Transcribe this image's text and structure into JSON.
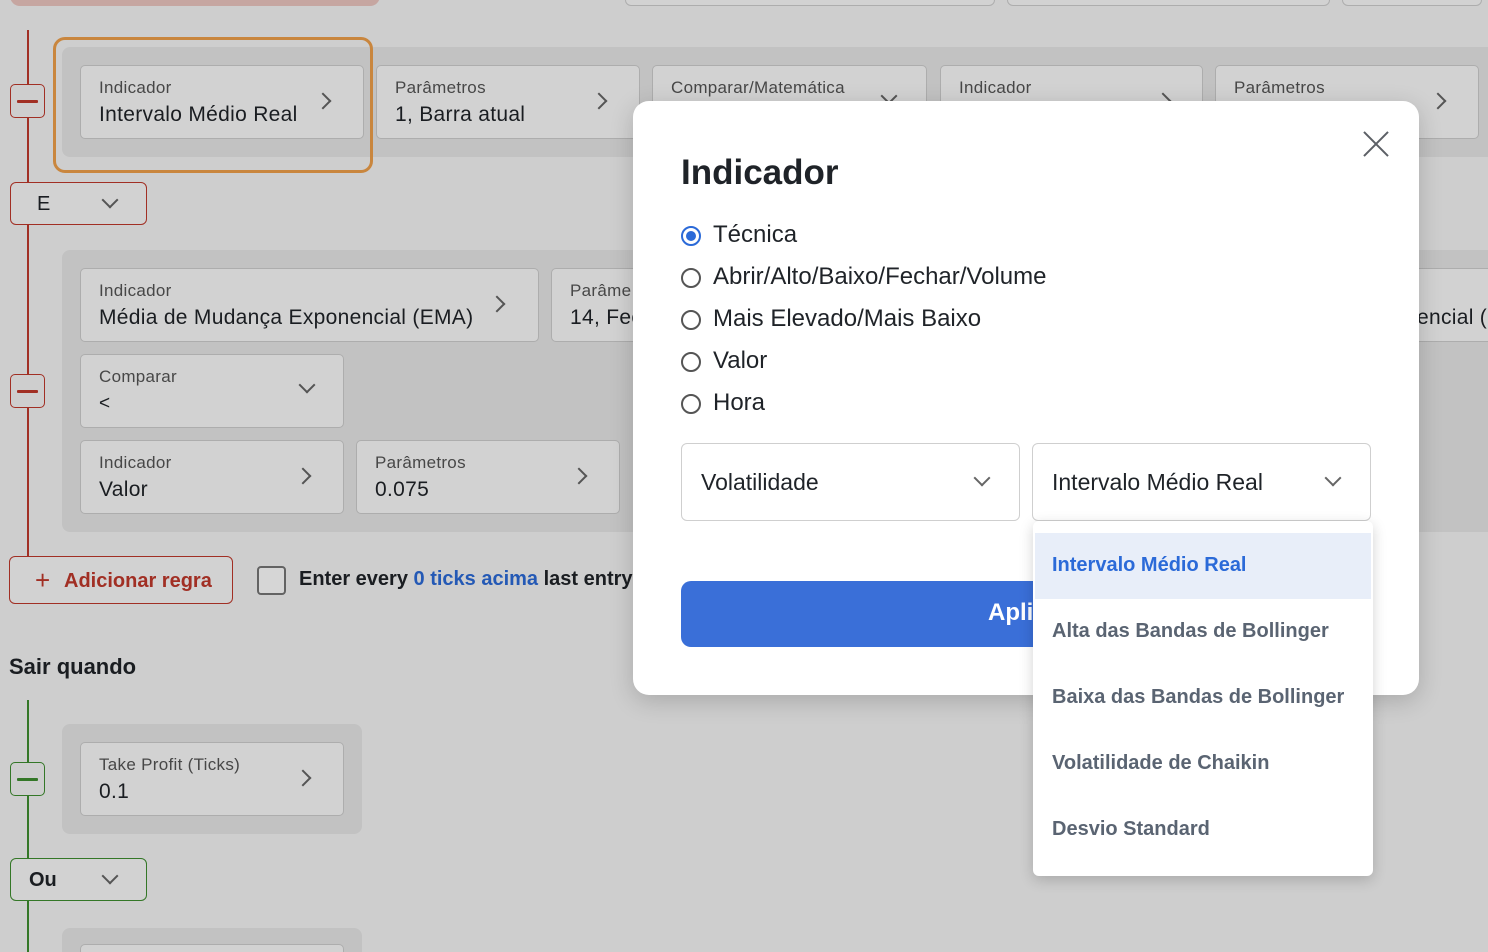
{
  "builder": {
    "row1": [
      {
        "label": "Indicador",
        "value": "Intervalo Médio Real"
      },
      {
        "label": "Parâmetros",
        "value": "1, Barra atual"
      },
      {
        "label": "Comparar/Matemática",
        "value": ""
      },
      {
        "label": "Indicador",
        "value": ""
      },
      {
        "label": "Parâmetros",
        "value": ""
      }
    ],
    "logic1": "E",
    "row2": [
      {
        "label": "Indicador",
        "value": "Média de Mudança Exponencial (EMA)"
      },
      {
        "label": "Parâme",
        "value": "14, Fec"
      },
      {
        "label": "",
        "value": "encial ("
      }
    ],
    "compare": {
      "label": "Comparar",
      "value": "<"
    },
    "row3": [
      {
        "label": "Indicador",
        "value": "Valor"
      },
      {
        "label": "Parâmetros",
        "value": "0.075"
      }
    ],
    "add_rule": "Adicionar regra",
    "enter_text": {
      "pre": "Enter every ",
      "link": "0 ticks acima",
      "post": " last entry"
    },
    "exit_title": "Sair quando",
    "exit_field": {
      "label": "Take Profit (Ticks)",
      "value": "0.1"
    },
    "logic2": "Ou"
  },
  "modal": {
    "title": "Indicador",
    "radios": [
      {
        "label": "Técnica",
        "checked": true
      },
      {
        "label": "Abrir/Alto/Baixo/Fechar/Volume",
        "checked": false
      },
      {
        "label": "Mais Elevado/Mais Baixo",
        "checked": false
      },
      {
        "label": "Valor",
        "checked": false
      },
      {
        "label": "Hora",
        "checked": false
      }
    ],
    "category_select": "Volatilidade",
    "indicator_select": "Intervalo Médio Real",
    "apply_label": "Aplicar",
    "dropdown_options": [
      {
        "label": "Intervalo Médio Real",
        "selected": true
      },
      {
        "label": "Alta das Bandas de Bollinger",
        "selected": false
      },
      {
        "label": "Baixa das Bandas de Bollinger",
        "selected": false
      },
      {
        "label": "Volatilidade de Chaikin",
        "selected": false
      },
      {
        "label": "Desvio Standard",
        "selected": false
      }
    ]
  },
  "colors": {
    "accent": "#3a6fd8",
    "entry_rule": "#c0392b",
    "exit_rule": "#3e8e2f",
    "highlight": "#f0a04b"
  }
}
